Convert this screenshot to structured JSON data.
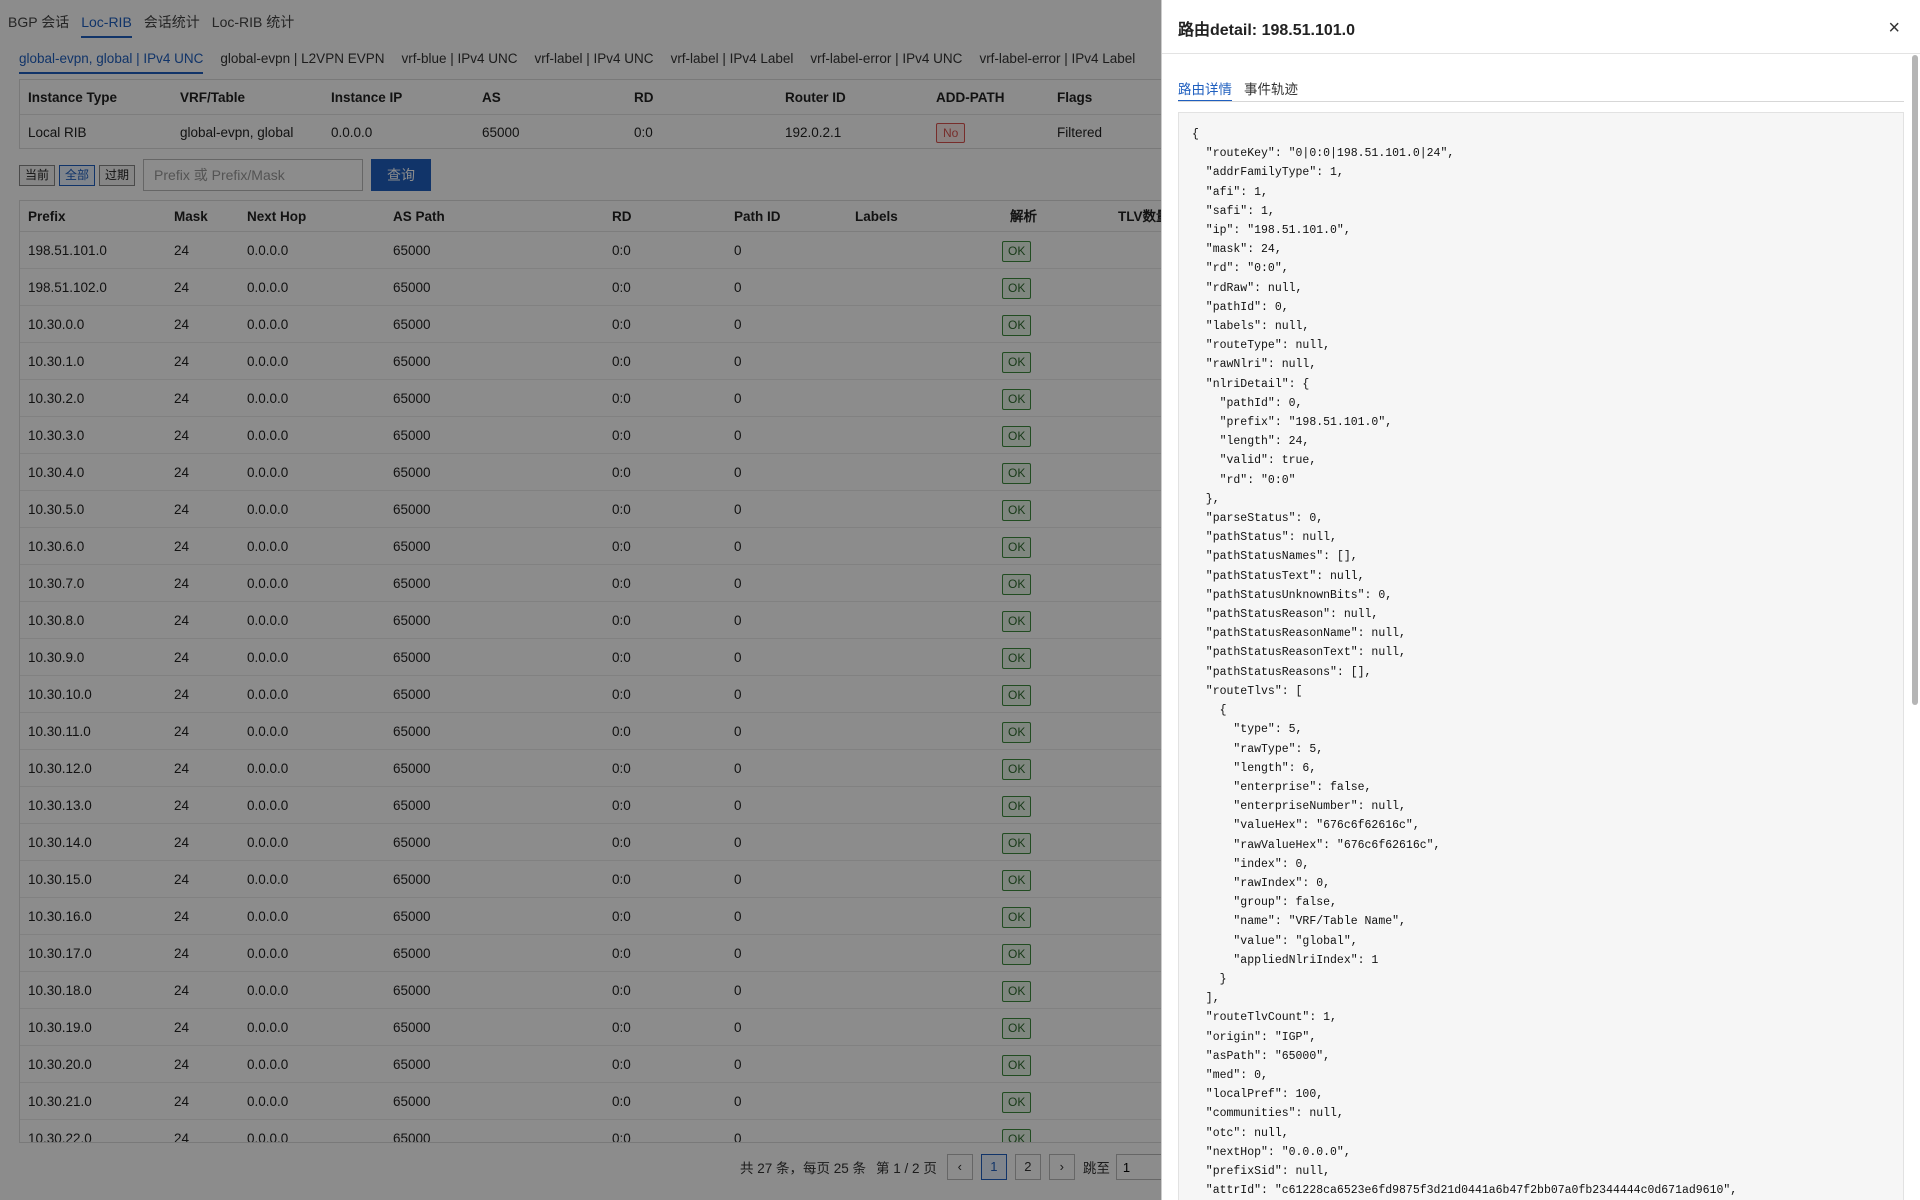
{
  "top_tabs": [
    "BGP 会话",
    "Loc-RIB",
    "会话统计",
    "Loc-RIB 统计"
  ],
  "top_tab_active": 1,
  "instance_tabs": [
    "global-evpn, global | IPv4 UNC",
    "global-evpn | L2VPN EVPN",
    "vrf-blue | IPv4 UNC",
    "vrf-label | IPv4 UNC",
    "vrf-label | IPv4 Label",
    "vrf-label-error | IPv4 UNC",
    "vrf-label-error | IPv4 Label"
  ],
  "instance_table": {
    "headers": [
      "Instance Type",
      "VRF/Table",
      "Instance IP",
      "AS",
      "RD",
      "Router ID",
      "ADD-PATH",
      "Flags"
    ],
    "row": {
      "instance_type": "Local RIB",
      "vrf_table": "global-evpn, global",
      "instance_ip": "0.0.0.0",
      "as": "65000",
      "rd": "0:0",
      "router_id": "192.0.2.1",
      "add_path": "No",
      "flags": "Filtered"
    }
  },
  "filter": {
    "buttons": [
      "当前",
      "全部",
      "过期"
    ],
    "active": 1,
    "search_placeholder": "Prefix 或 Prefix/Mask",
    "query_label": "查询"
  },
  "route_table": {
    "headers": [
      "Prefix",
      "Mask",
      "Next Hop",
      "AS Path",
      "RD",
      "Path ID",
      "Labels",
      "解析",
      "TLV数量"
    ],
    "rows": [
      {
        "prefix": "198.51.101.0",
        "mask": "24",
        "next_hop": "0.0.0.0",
        "as_path": "65000",
        "rd": "0:0",
        "path_id": "0",
        "labels": "",
        "parse": "OK"
      },
      {
        "prefix": "198.51.102.0",
        "mask": "24",
        "next_hop": "0.0.0.0",
        "as_path": "65000",
        "rd": "0:0",
        "path_id": "0",
        "labels": "",
        "parse": "OK"
      },
      {
        "prefix": "10.30.0.0",
        "mask": "24",
        "next_hop": "0.0.0.0",
        "as_path": "65000",
        "rd": "0:0",
        "path_id": "0",
        "labels": "",
        "parse": "OK"
      },
      {
        "prefix": "10.30.1.0",
        "mask": "24",
        "next_hop": "0.0.0.0",
        "as_path": "65000",
        "rd": "0:0",
        "path_id": "0",
        "labels": "",
        "parse": "OK"
      },
      {
        "prefix": "10.30.2.0",
        "mask": "24",
        "next_hop": "0.0.0.0",
        "as_path": "65000",
        "rd": "0:0",
        "path_id": "0",
        "labels": "",
        "parse": "OK"
      },
      {
        "prefix": "10.30.3.0",
        "mask": "24",
        "next_hop": "0.0.0.0",
        "as_path": "65000",
        "rd": "0:0",
        "path_id": "0",
        "labels": "",
        "parse": "OK"
      },
      {
        "prefix": "10.30.4.0",
        "mask": "24",
        "next_hop": "0.0.0.0",
        "as_path": "65000",
        "rd": "0:0",
        "path_id": "0",
        "labels": "",
        "parse": "OK"
      },
      {
        "prefix": "10.30.5.0",
        "mask": "24",
        "next_hop": "0.0.0.0",
        "as_path": "65000",
        "rd": "0:0",
        "path_id": "0",
        "labels": "",
        "parse": "OK"
      },
      {
        "prefix": "10.30.6.0",
        "mask": "24",
        "next_hop": "0.0.0.0",
        "as_path": "65000",
        "rd": "0:0",
        "path_id": "0",
        "labels": "",
        "parse": "OK"
      },
      {
        "prefix": "10.30.7.0",
        "mask": "24",
        "next_hop": "0.0.0.0",
        "as_path": "65000",
        "rd": "0:0",
        "path_id": "0",
        "labels": "",
        "parse": "OK"
      },
      {
        "prefix": "10.30.8.0",
        "mask": "24",
        "next_hop": "0.0.0.0",
        "as_path": "65000",
        "rd": "0:0",
        "path_id": "0",
        "labels": "",
        "parse": "OK"
      },
      {
        "prefix": "10.30.9.0",
        "mask": "24",
        "next_hop": "0.0.0.0",
        "as_path": "65000",
        "rd": "0:0",
        "path_id": "0",
        "labels": "",
        "parse": "OK"
      },
      {
        "prefix": "10.30.10.0",
        "mask": "24",
        "next_hop": "0.0.0.0",
        "as_path": "65000",
        "rd": "0:0",
        "path_id": "0",
        "labels": "",
        "parse": "OK"
      },
      {
        "prefix": "10.30.11.0",
        "mask": "24",
        "next_hop": "0.0.0.0",
        "as_path": "65000",
        "rd": "0:0",
        "path_id": "0",
        "labels": "",
        "parse": "OK"
      },
      {
        "prefix": "10.30.12.0",
        "mask": "24",
        "next_hop": "0.0.0.0",
        "as_path": "65000",
        "rd": "0:0",
        "path_id": "0",
        "labels": "",
        "parse": "OK"
      },
      {
        "prefix": "10.30.13.0",
        "mask": "24",
        "next_hop": "0.0.0.0",
        "as_path": "65000",
        "rd": "0:0",
        "path_id": "0",
        "labels": "",
        "parse": "OK"
      },
      {
        "prefix": "10.30.14.0",
        "mask": "24",
        "next_hop": "0.0.0.0",
        "as_path": "65000",
        "rd": "0:0",
        "path_id": "0",
        "labels": "",
        "parse": "OK"
      },
      {
        "prefix": "10.30.15.0",
        "mask": "24",
        "next_hop": "0.0.0.0",
        "as_path": "65000",
        "rd": "0:0",
        "path_id": "0",
        "labels": "",
        "parse": "OK"
      },
      {
        "prefix": "10.30.16.0",
        "mask": "24",
        "next_hop": "0.0.0.0",
        "as_path": "65000",
        "rd": "0:0",
        "path_id": "0",
        "labels": "",
        "parse": "OK"
      },
      {
        "prefix": "10.30.17.0",
        "mask": "24",
        "next_hop": "0.0.0.0",
        "as_path": "65000",
        "rd": "0:0",
        "path_id": "0",
        "labels": "",
        "parse": "OK"
      },
      {
        "prefix": "10.30.18.0",
        "mask": "24",
        "next_hop": "0.0.0.0",
        "as_path": "65000",
        "rd": "0:0",
        "path_id": "0",
        "labels": "",
        "parse": "OK"
      },
      {
        "prefix": "10.30.19.0",
        "mask": "24",
        "next_hop": "0.0.0.0",
        "as_path": "65000",
        "rd": "0:0",
        "path_id": "0",
        "labels": "",
        "parse": "OK"
      },
      {
        "prefix": "10.30.20.0",
        "mask": "24",
        "next_hop": "0.0.0.0",
        "as_path": "65000",
        "rd": "0:0",
        "path_id": "0",
        "labels": "",
        "parse": "OK"
      },
      {
        "prefix": "10.30.21.0",
        "mask": "24",
        "next_hop": "0.0.0.0",
        "as_path": "65000",
        "rd": "0:0",
        "path_id": "0",
        "labels": "",
        "parse": "OK"
      },
      {
        "prefix": "10.30.22.0",
        "mask": "24",
        "next_hop": "0.0.0.0",
        "as_path": "65000",
        "rd": "0:0",
        "path_id": "0",
        "labels": "",
        "parse": "OK"
      }
    ]
  },
  "pagination": {
    "summary": "共 27 条，每页 25 条",
    "page_info": "第 1 / 2 页",
    "prev": "‹",
    "pages": [
      "1",
      "2"
    ],
    "active_page": "1",
    "next": "›",
    "jump_label": "跳至",
    "jump_value": "1"
  },
  "drawer": {
    "title": "路由detail: 198.51.101.0",
    "close": "×",
    "tabs": [
      "路由详情",
      "事件轨迹"
    ],
    "active_tab": 0,
    "json_lines": [
      "{",
      "  \"routeKey\": \"0|0:0|198.51.101.0|24\",",
      "  \"addrFamilyType\": 1,",
      "  \"afi\": 1,",
      "  \"safi\": 1,",
      "  \"ip\": \"198.51.101.0\",",
      "  \"mask\": 24,",
      "  \"rd\": \"0:0\",",
      "  \"rdRaw\": null,",
      "  \"pathId\": 0,",
      "  \"labels\": null,",
      "  \"routeType\": null,",
      "  \"rawNlri\": null,",
      "  \"nlriDetail\": {",
      "    \"pathId\": 0,",
      "    \"prefix\": \"198.51.101.0\",",
      "    \"length\": 24,",
      "    \"valid\": true,",
      "    \"rd\": \"0:0\"",
      "  },",
      "  \"parseStatus\": 0,",
      "  \"pathStatus\": null,",
      "  \"pathStatusNames\": [],",
      "  \"pathStatusText\": null,",
      "  \"pathStatusUnknownBits\": 0,",
      "  \"pathStatusReason\": null,",
      "  \"pathStatusReasonName\": null,",
      "  \"pathStatusReasonText\": null,",
      "  \"pathStatusReasons\": [],",
      "  \"routeTlvs\": [",
      "    {",
      "      \"type\": 5,",
      "      \"rawType\": 5,",
      "      \"length\": 6,",
      "      \"enterprise\": false,",
      "      \"enterpriseNumber\": null,",
      "      \"valueHex\": \"676c6f62616c\",",
      "      \"rawValueHex\": \"676c6f62616c\",",
      "      \"index\": 0,",
      "      \"rawIndex\": 0,",
      "      \"group\": false,",
      "      \"name\": \"VRF/Table Name\",",
      "      \"value\": \"global\",",
      "      \"appliedNlriIndex\": 1",
      "    }",
      "  ],",
      "  \"routeTlvCount\": 1,",
      "  \"origin\": \"IGP\",",
      "  \"asPath\": \"65000\",",
      "  \"med\": 0,",
      "  \"localPref\": 100,",
      "  \"communities\": null,",
      "  \"otc\": null,",
      "  \"nextHop\": \"0.0.0.0\",",
      "  \"prefixSid\": null,",
      "  \"attrId\": \"c61228ca6523e6fd9875f3d21d0441a6b47f2bb07a0fb2344444c0d671ad9610\","
    ]
  }
}
